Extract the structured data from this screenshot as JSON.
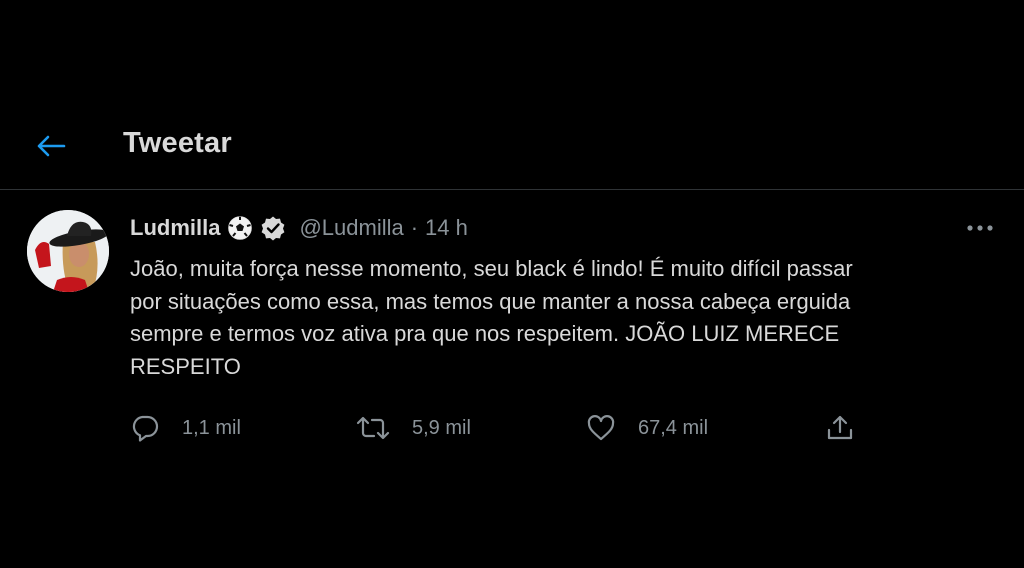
{
  "header": {
    "title": "Tweetar",
    "back_icon": "arrow-left-icon"
  },
  "colors": {
    "background": "#000000",
    "accent": "#1d9bf0",
    "text": "#d9d9d9",
    "muted": "#8b9399",
    "divider": "#2f3336"
  },
  "tweet": {
    "author": {
      "display_name": "Ludmilla",
      "emoji_icon": "soccer-ball-icon",
      "verified_icon": "verified-badge-icon",
      "handle": "@Ludmilla",
      "separator": "·",
      "time": "14 h"
    },
    "text_lines": [
      "João, muita força nesse momento, seu black é lindo! É muito difícil passar",
      "por situações como essa, mas temos que manter a nossa cabeça erguida",
      "sempre e termos voz ativa pra que nos respeitem. JOÃO LUIZ MERECE",
      "RESPEITO"
    ],
    "more_icon": "more-horizontal-icon",
    "actions": {
      "reply": {
        "icon": "reply-icon",
        "count": "1,1 mil"
      },
      "retweet": {
        "icon": "retweet-icon",
        "count": "5,9 mil"
      },
      "like": {
        "icon": "heart-icon",
        "count": "67,4 mil"
      },
      "share": {
        "icon": "share-icon"
      }
    }
  }
}
